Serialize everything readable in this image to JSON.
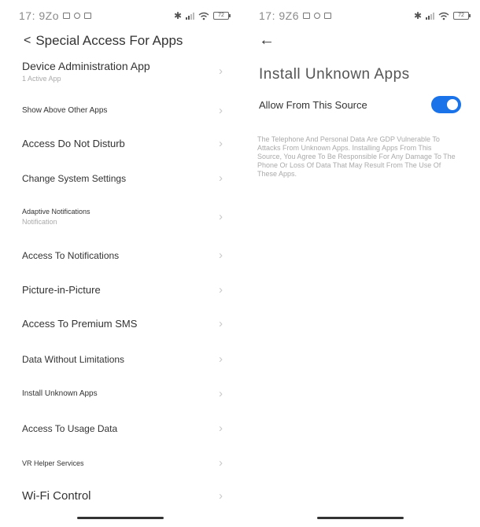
{
  "left_screen": {
    "status_bar": {
      "time": "17: 9Zo",
      "battery": "72"
    },
    "header": {
      "back_label": "<",
      "title": "Special Access For Apps"
    },
    "items": [
      {
        "title": "Device Administration App",
        "subtitle": "1 Active App"
      },
      {
        "title": "Show Above Other Apps",
        "subtitle": ""
      },
      {
        "title": "Access Do Not Disturb",
        "subtitle": ""
      },
      {
        "title": "Change System Settings",
        "subtitle": ""
      },
      {
        "title": "Adaptive Notifications",
        "subtitle": "Notification"
      },
      {
        "title": "Access To Notifications",
        "subtitle": ""
      },
      {
        "title": "Picture-in-Picture",
        "subtitle": ""
      },
      {
        "title": "Access To Premium SMS",
        "subtitle": ""
      },
      {
        "title": "Data Without Limitations",
        "subtitle": ""
      },
      {
        "title": "Install Unknown Apps",
        "subtitle": ""
      },
      {
        "title": "Access To Usage Data",
        "subtitle": ""
      },
      {
        "title": "VR Helper Services",
        "subtitle": ""
      },
      {
        "title": "Wi-Fi Control",
        "subtitle": ""
      }
    ],
    "chevron": "›"
  },
  "right_screen": {
    "status_bar": {
      "time": "17: 9Z6",
      "battery": "72"
    },
    "back_arrow": "←",
    "title": "Install Unknown Apps",
    "toggle": {
      "label": "Allow From This Source",
      "on": true,
      "color": "#1a73e8"
    },
    "warning": "The Telephone And Personal Data Are GDP Vulnerable To Attacks From Unknown Apps. Installing Apps From This Source, You Agree To Be Responsible For Any Damage To The Phone Or Loss Of Data That May Result From The Use Of These Apps."
  }
}
